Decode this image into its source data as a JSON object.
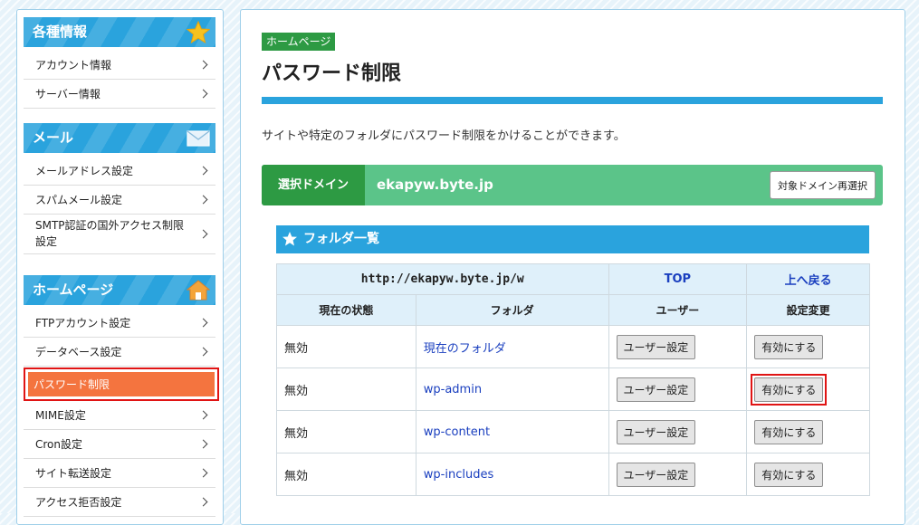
{
  "sidebar": {
    "sections": [
      {
        "title": "各種情報",
        "icon": "star-icon",
        "items": [
          {
            "label": "アカウント情報"
          },
          {
            "label": "サーバー情報"
          }
        ]
      },
      {
        "title": "メール",
        "icon": "mail-icon",
        "items": [
          {
            "label": "メールアドレス設定"
          },
          {
            "label": "スパムメール設定"
          },
          {
            "label": "SMTP認証の国外アクセス制限設定"
          }
        ]
      },
      {
        "title": "ホームページ",
        "icon": "home-icon",
        "items": [
          {
            "label": "FTPアカウント設定"
          },
          {
            "label": "データベース設定"
          },
          {
            "label": "パスワード制限",
            "active": true
          },
          {
            "label": "MIME設定"
          },
          {
            "label": "Cron設定"
          },
          {
            "label": "サイト転送設定"
          },
          {
            "label": "アクセス拒否設定"
          }
        ]
      }
    ]
  },
  "page": {
    "breadcrumb": "ホームページ",
    "title": "パスワード制限",
    "description": "サイトや特定のフォルダにパスワード制限をかけることができます。"
  },
  "domain": {
    "label": "選択ドメイン",
    "value": "ekapyw.byte.jp",
    "reselect_button": "対象ドメイン再選択"
  },
  "folder_list": {
    "title": "フォルダ一覧",
    "url": "http://ekapyw.byte.jp/w",
    "top_link": "TOP",
    "up_link": "上へ戻る",
    "columns": [
      "現在の状態",
      "フォルダ",
      "ユーザー",
      "設定変更"
    ],
    "rows": [
      {
        "state": "無効",
        "folder": "現在のフォルダ",
        "user_button": "ユーザー設定",
        "action_button": "有効にする"
      },
      {
        "state": "無効",
        "folder": "wp-admin",
        "user_button": "ユーザー設定",
        "action_button": "有効にする",
        "highlight": true
      },
      {
        "state": "無効",
        "folder": "wp-content",
        "user_button": "ユーザー設定",
        "action_button": "有効にする"
      },
      {
        "state": "無効",
        "folder": "wp-includes",
        "user_button": "ユーザー設定",
        "action_button": "有効にする"
      }
    ]
  },
  "colors": {
    "accent_blue": "#2aa3dd",
    "green_dark": "#2d9a43",
    "green_light": "#5bc489",
    "active_orange": "#f4743f",
    "highlight_red": "#e01414",
    "link_blue": "#1a3fbf"
  }
}
